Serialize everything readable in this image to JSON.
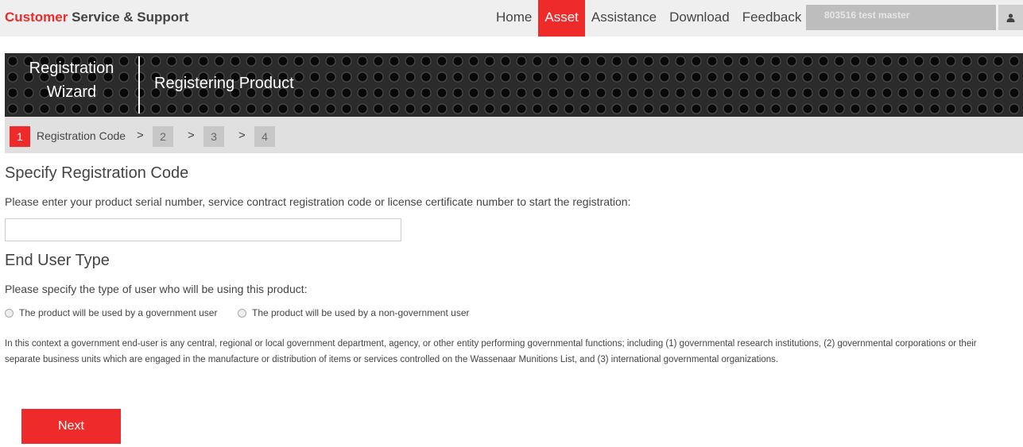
{
  "header": {
    "brand_accent": "Customer",
    "brand_rest": " Service & Support",
    "nav": [
      "Home",
      "Asset",
      "Assistance",
      "Download",
      "Feedback"
    ],
    "active_nav": "Asset",
    "user_name": "803516 test master",
    "user_icon": "user-icon"
  },
  "banner": {
    "title_line1": "Registration",
    "title_line2": "Wizard",
    "subtitle": "Registering Product"
  },
  "steps": {
    "items": [
      "1",
      "2",
      "3",
      "4"
    ],
    "active_label": "Registration Code",
    "separator": ">"
  },
  "registration": {
    "heading": "Specify Registration Code",
    "instruction": "Please enter your product serial number, service contract registration code or license certificate number to start the registration:",
    "input_value": ""
  },
  "end_user": {
    "heading": "End User Type",
    "instruction": "Please specify the type of user who will be using this product:",
    "options": [
      "The product will be used by a government user",
      "The product will be used by a non-government user"
    ],
    "note": "In this context a government end-user is any central, regional or local government department, agency, or other entity performing governmental functions; including (1) governmental research institutions, (2) governmental corporations or their separate business units which are engaged in the manufacture or distribution of items or services controlled on the Wassenaar Munitions List, and (3) international governmental organizations."
  },
  "actions": {
    "next_label": "Next"
  },
  "colors": {
    "accent": "#ee2a2a",
    "topbar_bg": "#efefef",
    "steps_bg": "#e0e0e0"
  }
}
